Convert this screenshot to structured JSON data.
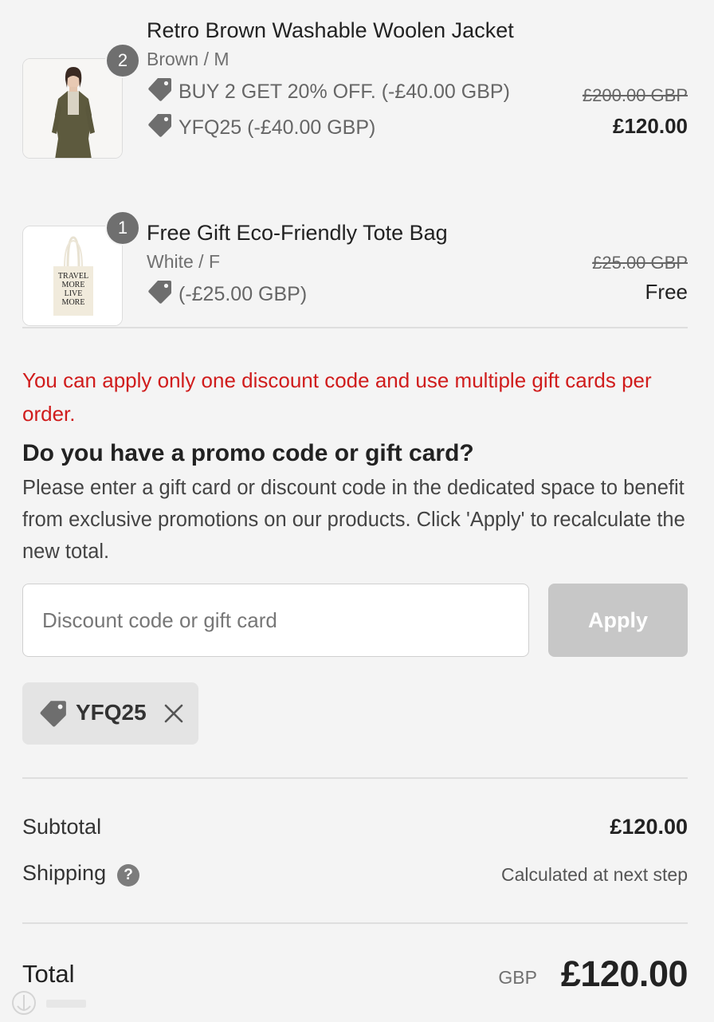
{
  "items": [
    {
      "quantity": "2",
      "title": "Retro Brown Washable Woolen Jacket",
      "variant": "Brown / M",
      "discounts": [
        {
          "text": "BUY 2 GET 20% OFF. (-£40.00 GBP)"
        },
        {
          "text": "YFQ25 (-£40.00 GBP)"
        }
      ],
      "old_price": "£200.00 GBP",
      "price": "£120.00",
      "image": "brown-jacket-model-photo"
    },
    {
      "quantity": "1",
      "title": "Free Gift Eco-Friendly Tote Bag",
      "variant": "White / F",
      "discounts": [
        {
          "text": "(-£25.00 GBP)"
        }
      ],
      "old_price": "£25.00 GBP",
      "price": "Free",
      "image": "tote-bag-photo",
      "tote_text": [
        "TRAVEL",
        "MORE",
        "LIVE",
        "MORE"
      ]
    }
  ],
  "notice": "You can apply only one discount code and use multiple gift cards per order.",
  "promo": {
    "heading": "Do you have a promo code or gift card?",
    "description": "Please enter a gift card or discount code in the dedicated space to benefit from exclusive promotions on our products. Click 'Apply' to recalculate the new total.",
    "input_placeholder": "Discount code or gift card",
    "input_value": "",
    "apply_label": "Apply",
    "applied_code": "YFQ25"
  },
  "summary": {
    "subtotal_label": "Subtotal",
    "subtotal_value": "£120.00",
    "shipping_label": "Shipping",
    "shipping_help": "?",
    "shipping_value": "Calculated at next step",
    "total_label": "Total",
    "total_currency": "GBP",
    "total_value": "£120.00"
  },
  "icons": {
    "discount_tag": "tag-icon",
    "remove": "close-icon",
    "shipping_info": "question-circle-icon"
  },
  "colors": {
    "background": "#f4f4f4",
    "notice_red": "#d01c1c",
    "apply_disabled": "#c7c7c7",
    "badge": "#6f6f6f",
    "chip": "#e4e4e4"
  }
}
